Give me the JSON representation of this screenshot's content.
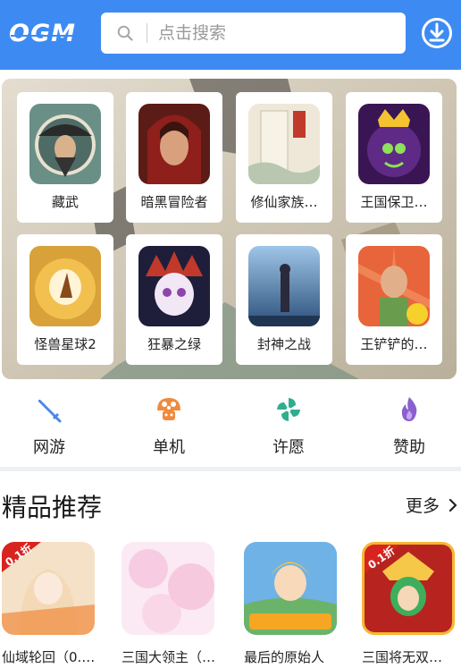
{
  "header": {
    "logo": "OGM",
    "search_placeholder": "点击搜索"
  },
  "banner_games": [
    {
      "label": "藏武"
    },
    {
      "label": "暗黑冒险者"
    },
    {
      "label": "修仙家族…"
    },
    {
      "label": "王国保卫…"
    },
    {
      "label": "怪兽星球2"
    },
    {
      "label": "狂暴之绿"
    },
    {
      "label": "封神之战"
    },
    {
      "label": "王铲铲的…"
    }
  ],
  "categories": [
    {
      "label": "网游",
      "icon": "sword-icon",
      "color": "#4a86e8"
    },
    {
      "label": "单机",
      "icon": "mushroom-icon",
      "color": "#f08a3c"
    },
    {
      "label": "许愿",
      "icon": "pinwheel-icon",
      "color": "#2fae8f"
    },
    {
      "label": "赞助",
      "icon": "flame-icon",
      "color": "#8b5fd0"
    }
  ],
  "section": {
    "title": "精品推荐",
    "more": "更多"
  },
  "recommended": [
    {
      "label": "仙域轮回（0.…",
      "badge": "0.1折"
    },
    {
      "label": "三国大领主（…"
    },
    {
      "label": "最后的原始人"
    },
    {
      "label": "三国将无双…",
      "badge": "0.1折"
    }
  ],
  "colors": {
    "brand": "#3d8bf2",
    "divider": "#eef1f4"
  }
}
